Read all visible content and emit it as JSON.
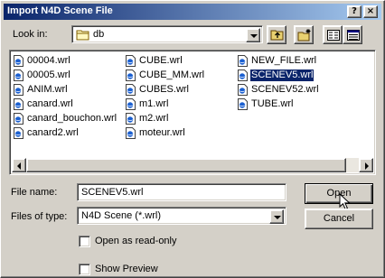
{
  "window": {
    "title": "Import N4D Scene File",
    "help_label": "?",
    "close_label": "×"
  },
  "look_in": {
    "label": "Look in:",
    "value": "db"
  },
  "files": {
    "columns": [
      [
        "00004.wrl",
        "00005.wrl",
        "ANIM.wrl",
        "canard.wrl",
        "canard_bouchon.wrl",
        "canard2.wrl"
      ],
      [
        "CUBE.wrl",
        "CUBE_MM.wrl",
        "CUBES.wrl",
        "m1.wrl",
        "m2.wrl",
        "moteur.wrl"
      ],
      [
        "NEW_FILE.wrl",
        "SCENEV5.wrl",
        "SCENEV52.wrl",
        "TUBE.wrl"
      ]
    ],
    "selected": "SCENEV5.wrl"
  },
  "file_name": {
    "label": "File name:",
    "value": "SCENEV5.wrl"
  },
  "file_type": {
    "label": "Files of type:",
    "value": "N4D Scene (*.wrl)"
  },
  "buttons": {
    "open": "Open",
    "cancel": "Cancel"
  },
  "options": {
    "read_only": "Open as read-only",
    "show_preview": "Show Preview"
  },
  "colors": {
    "title_start": "#0a246a",
    "title_end": "#a6caf0",
    "selection": "#0a246a",
    "face": "#d4d0c8"
  }
}
